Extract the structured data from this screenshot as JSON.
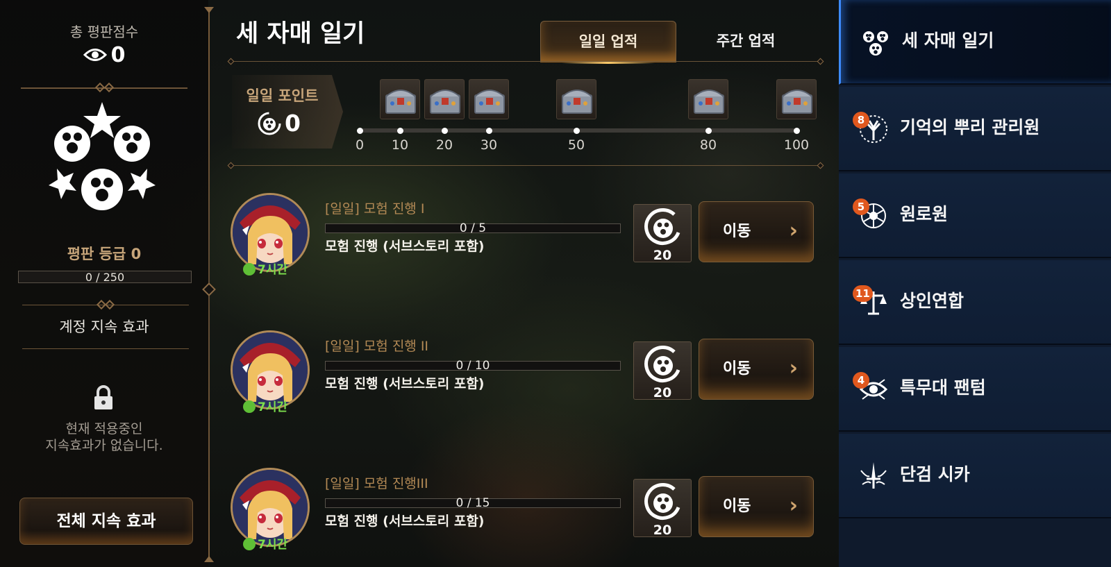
{
  "left": {
    "total_label": "총 평판점수",
    "total_value": "0",
    "grade_label": "평판 등급 0",
    "progress_text": "0 / 250",
    "progress_fraction": 0,
    "account_effect_label": "계정 지속 효과",
    "no_effect_line1": "현재 적용중인",
    "no_effect_line2": "지속효과가 없습니다.",
    "all_effect_button": "전체 지속 효과"
  },
  "header": {
    "title": "세 자매 일기",
    "tabs": [
      {
        "label": "일일 업적",
        "active": true
      },
      {
        "label": "주간 업적",
        "active": false
      }
    ]
  },
  "points": {
    "label": "일일 포인트",
    "value": "0",
    "milestones": [
      "0",
      "10",
      "20",
      "30",
      "50",
      "80",
      "100"
    ]
  },
  "quests": [
    {
      "title": "[일일] 모험 진행 I",
      "progress_text": "0 / 5",
      "description": "모험 진행 (서브스토리 포함)",
      "timer": "7시간",
      "reward": "20",
      "button": "이동"
    },
    {
      "title": "[일일] 모험 진행 II",
      "progress_text": "0 / 10",
      "description": "모험 진행 (서브스토리 포함)",
      "timer": "7시간",
      "reward": "20",
      "button": "이동"
    },
    {
      "title": "[일일] 모험 진행III",
      "progress_text": "0 / 15",
      "description": "모험 진행 (서브스토리 포함)",
      "timer": "7시간",
      "reward": "20",
      "button": "이동"
    }
  ],
  "sidebar": {
    "items": [
      {
        "label": "세 자매 일기",
        "badge": "",
        "icon": "three-sisters-icon",
        "active": true
      },
      {
        "label": "기억의 뿌리 관리원",
        "badge": "8",
        "icon": "memory-tree-icon",
        "active": false
      },
      {
        "label": "원로원",
        "badge": "5",
        "icon": "council-icon",
        "active": false
      },
      {
        "label": "상인연합",
        "badge": "11",
        "icon": "merchant-scale-icon",
        "active": false
      },
      {
        "label": "특무대 팬텀",
        "badge": "4",
        "icon": "phantom-eye-icon",
        "active": false
      },
      {
        "label": "단검 시카",
        "badge": "",
        "icon": "dagger-icon",
        "active": false
      }
    ]
  },
  "colors": {
    "accent_gold": "#c7a57a",
    "quest_title": "#b48a55",
    "timer_green": "#7de04d",
    "badge_orange": "#e0581e",
    "sidebar_blue": "#12223a",
    "active_highlight": "#3d8bff"
  }
}
